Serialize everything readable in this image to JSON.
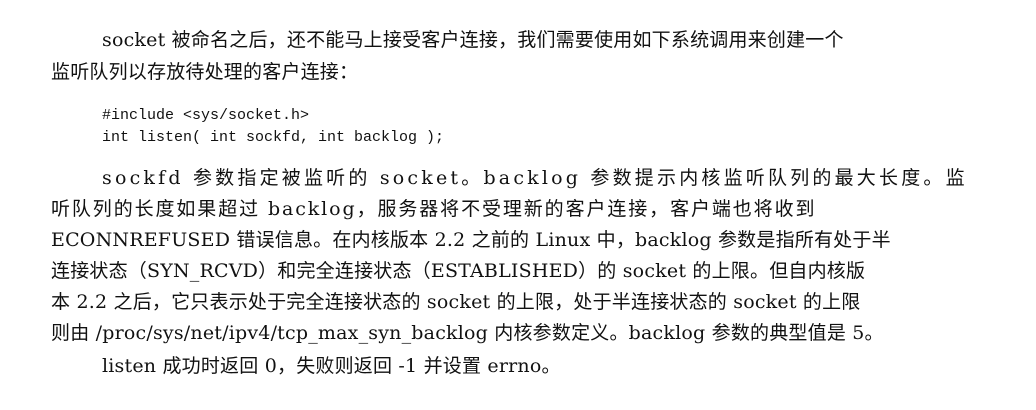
{
  "paragraph_1": {
    "line_1": "socket 被命名之后，还不能马上接受客户连接，我们需要使用如下系统调用来创建一个",
    "line_2": "监听队列以存放待处理的客户连接："
  },
  "code": {
    "line_1": "#include <sys/socket.h>",
    "line_2": "int listen( int sockfd, int backlog );"
  },
  "paragraph_2": {
    "line_1": "sockfd 参数指定被监听的 socket。backlog 参数提示内核监听队列的最大长度。监",
    "line_2": "听队列的长度如果超过 backlog，服务器将不受理新的客户连接，客户端也将收到",
    "line_3": "ECONNREFUSED 错误信息。在内核版本 2.2 之前的 Linux 中，backlog 参数是指所有处于半",
    "line_4": "连接状态（SYN_RCVD）和完全连接状态（ESTABLISHED）的 socket 的上限。但自内核版",
    "line_5": "本 2.2 之后，它只表示处于完全连接状态的 socket 的上限，处于半连接状态的 socket 的上限",
    "line_6": "则由 /proc/sys/net/ipv4/tcp_max_syn_backlog 内核参数定义。backlog 参数的典型值是 5。"
  },
  "paragraph_3": {
    "line_1": "listen 成功时返回 0，失败则返回 -1 并设置 errno。"
  }
}
